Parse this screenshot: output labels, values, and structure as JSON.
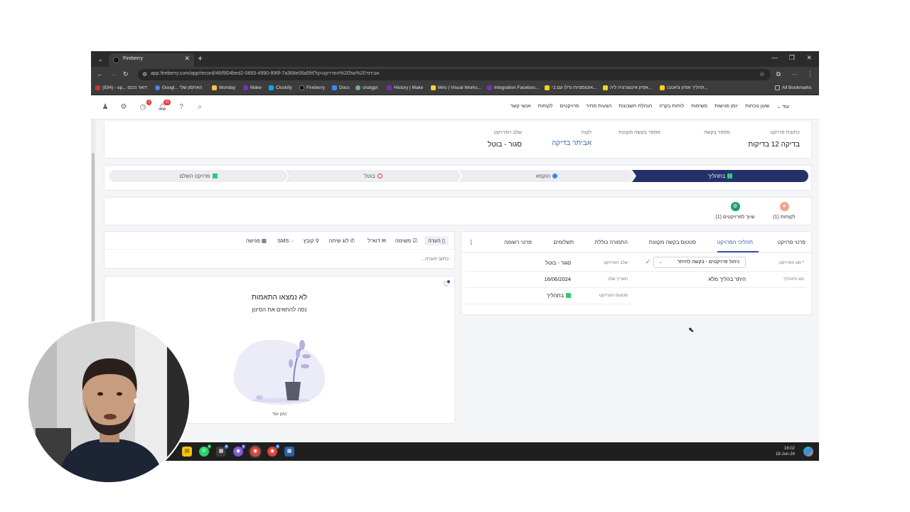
{
  "browser": {
    "tab_title": "Fireberry",
    "url": "app.fireberry.com/app/record/46/f804bed2-0893-4990-896f-7a368e06a5fd?q=אביתר%20של%20הפרויקט",
    "bookmarks": [
      {
        "label": "(834) - op... דואר נכנס",
        "color": "#c0392b"
      },
      {
        "label": "Googl... האחסון שלי",
        "color": "#4285f4"
      },
      {
        "label": "Monday",
        "color": "#f4c542"
      },
      {
        "label": "Make",
        "color": "#7b2cbf"
      },
      {
        "label": "Clockify",
        "color": "#03a9f4"
      },
      {
        "label": "Fireberry",
        "color": "#222222"
      },
      {
        "label": "Docs",
        "color": "#4285f4"
      },
      {
        "label": "chatgpt",
        "color": "#74aa9c"
      },
      {
        "label": "History | Make",
        "color": "#7b2cbf"
      },
      {
        "label": "Miro | Visual Works...",
        "color": "#ffd02f"
      },
      {
        "label": "Integration Faceboo...",
        "color": "#7b2cbf"
      },
      {
        "label": "אוטומציות נדלן עם בי...",
        "color": "#f7d21c"
      },
      {
        "label": "אפיון אינטגרציה ליה...",
        "color": "#f7d21c"
      },
      {
        "label": "תהליך אפיון צ'אטבו...",
        "color": "#f7d21c"
      },
      {
        "label": "All Bookmarks",
        "color": "#bbbbbb"
      }
    ]
  },
  "header": {
    "nav_items": [
      "אנשי קשר",
      "לקוחות",
      "פרויקטים",
      "הצעות מחיר",
      "הנהלת חשבונות",
      "לוחות בקרה",
      "משימות",
      "יומן פגישות",
      "שעון נוכחות",
      "עוד"
    ],
    "icons": [
      "user-icon",
      "gear-icon",
      "clock-icon",
      "bell-icon",
      "help-icon",
      "search-icon"
    ],
    "clock_badge": "3",
    "bell_badge": "31"
  },
  "record": {
    "fields": [
      {
        "label": "כתובת פרויקט",
        "value": "בדיקה 12 בדיקות"
      },
      {
        "label": "מספר בקשה",
        "value": ""
      },
      {
        "label": "מספר בקשה מקוונת",
        "value": ""
      },
      {
        "label": "לקוח",
        "value": "אביתר בדיקה"
      },
      {
        "label": "שלב הפרויקט",
        "value": "סגור - בוטל"
      }
    ]
  },
  "stages": [
    {
      "label": "בתהליך",
      "state": "active",
      "icon_color": "#2ecc71"
    },
    {
      "label": "הוקפא",
      "state": "idle",
      "icon_color": "#3b82f6"
    },
    {
      "label": "בוטל",
      "state": "idle",
      "icon_color": "#e53935"
    },
    {
      "label": "פרויקט השלם",
      "state": "idle",
      "icon_color": "#2ecc71"
    }
  ],
  "related": [
    {
      "label": "לקוחות (1)",
      "color": "#f0a58a"
    },
    {
      "label": "שיוך לפרויקטים (1)",
      "color": "#1aa06d"
    }
  ],
  "detail_tabs": [
    "פרטי פרויקט",
    "תהליכי הפרויקט",
    "סטטוס בקשה מקוונת",
    "התמורה כוללת",
    "תשלומים",
    "פרטי רשומה"
  ],
  "detail_rows": {
    "project_type_label": "סוג הפרויקט",
    "project_type_value": "ניהול פרויקטים - בקשה להיתר",
    "process_type_label": "סוג התהליך",
    "process_type_value": "היתר בהליך מלא",
    "stage_label": "שלב הפרויקט",
    "stage_value": "סגור - בוטל",
    "stage_date_label": "תאריך שלב",
    "stage_date_value": "16/06/2024",
    "status_label": "סטטוס הפרויקט",
    "status_value": "בתהליך"
  },
  "activity": {
    "tabs": [
      "הערה",
      "משימה",
      "דוא\"ל",
      "לוג שיחה",
      "קובץ",
      "SMS",
      "פגישה"
    ],
    "note_placeholder": "כתוב הערה...",
    "empty_title": "לא נמצאו התאמות",
    "empty_subtitle": "נסה להתאים את הסינון",
    "load_more": "טען עוד"
  },
  "taskbar": {
    "time": "16:02",
    "date": "18-Jun-24"
  }
}
